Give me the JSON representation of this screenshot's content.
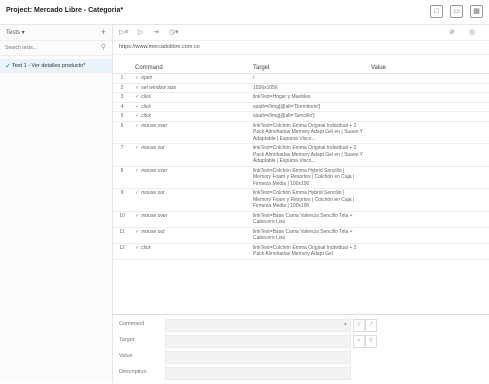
{
  "title": "Project: Mercado Libre - Categoria*",
  "window_icons": [
    "new-project-icon",
    "open-project-icon",
    "save-project-icon"
  ],
  "sidebar": {
    "tests_label": "Tests",
    "add_label": "+",
    "search_placeholder": "Search tests...",
    "test_item": "Test 1 - Ver detalles producto*"
  },
  "toolbar": {
    "run_all": "▷≡",
    "run": "▷",
    "step": "⇥",
    "speed": "◷▾",
    "disable_breakpoints": "⊘",
    "settings": "◎"
  },
  "url": "https://www.mercadolibre.com.co",
  "table": {
    "headers": [
      "Command",
      "Target",
      "Value"
    ],
    "rows": [
      {
        "num": "1",
        "command": "open",
        "target": "/"
      },
      {
        "num": "2",
        "command": "set window size",
        "target": "1936x1056"
      },
      {
        "num": "3",
        "command": "click",
        "target": "linkText=Hogar y Muebles"
      },
      {
        "num": "4",
        "command": "click",
        "target": "xpath=//img[@alt='Dormitorio']"
      },
      {
        "num": "5",
        "command": "click",
        "target": "xpath=//img[@alt='Sencillo']"
      },
      {
        "num": "6",
        "command": "mouse over",
        "target": "linkText=Colchón Emma Original Individual + 2 Pack Almohadas Memory Adapt Gel en | Suave Y Adaptable | Espuma Visco..."
      },
      {
        "num": "7",
        "command": "mouse out",
        "target": "linkText=Colchón Emma Original Individual + 2 Pack Almohadas Memory Adapt Gel en | Suave Y Adaptable | Espuma Visco..."
      },
      {
        "num": "8",
        "command": "mouse over",
        "target": "linkText=Colchón Emma Hybrid Sencillo | Memory Foam y Resortes | Colchón en Caja | Firmeza Media | 100x190"
      },
      {
        "num": "9",
        "command": "mouse out",
        "target": "linkText=Colchón Emma Hybrid Sencillo | Memory Foam y Resortes | Colchón en Caja | Firmeza Media | 100x190"
      },
      {
        "num": "10",
        "command": "mouse over",
        "target": "linkText=Base Cama Valencia Sencillo Tela + Cabecero Liso"
      },
      {
        "num": "11",
        "command": "mouse out",
        "target": "linkText=Base Cama Valencia Sencillo Tela + Cabecero Liso"
      },
      {
        "num": "12",
        "command": "click",
        "target": "linkText=Colchón Emma Original Individual + 2 Pack Almohadas Memory Adapt Gel"
      }
    ]
  },
  "editor": {
    "command_label": "Command",
    "target_label": "Target",
    "value_label": "Value",
    "description_label": "Description"
  },
  "colors": {
    "pass": "#3a9c4e",
    "selected_bg": "#eaf3fb"
  }
}
